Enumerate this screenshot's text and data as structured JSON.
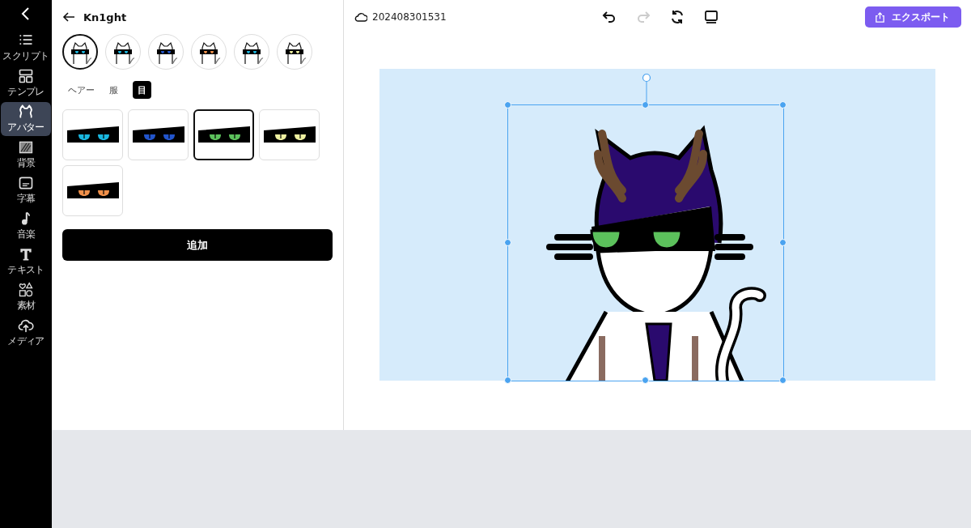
{
  "sidebar": {
    "items": [
      {
        "kind": "script",
        "label": "スクリプト",
        "selected": false
      },
      {
        "kind": "template",
        "label": "テンプレ",
        "selected": false
      },
      {
        "kind": "avatar",
        "label": "アバター",
        "selected": true
      },
      {
        "kind": "background",
        "label": "背景",
        "selected": false
      },
      {
        "kind": "subtitle",
        "label": "字幕",
        "selected": false
      },
      {
        "kind": "music",
        "label": "音楽",
        "selected": false
      },
      {
        "kind": "text",
        "label": "テキスト",
        "selected": false
      },
      {
        "kind": "material",
        "label": "素材",
        "selected": false
      },
      {
        "kind": "media",
        "label": "メディア",
        "selected": false
      }
    ]
  },
  "panel": {
    "title": "Kn1ght",
    "avatars": [
      {
        "color": "#1ab7df",
        "selected": true
      },
      {
        "color": "#1ab7df",
        "selected": false
      },
      {
        "color": "#2255cc",
        "selected": false
      },
      {
        "color": "#f0904a",
        "selected": false
      },
      {
        "color": "#1ab7df",
        "selected": false
      },
      {
        "color": "#eef0a0",
        "selected": false
      }
    ],
    "tabs": [
      {
        "label": "ヘアー",
        "selected": false
      },
      {
        "label": "服",
        "selected": false
      },
      {
        "label": "目",
        "selected": true
      }
    ],
    "options": [
      {
        "color": "#1ab7df",
        "selected": false
      },
      {
        "color": "#2255cc",
        "selected": false
      },
      {
        "color": "#5cc15c",
        "selected": true
      },
      {
        "color": "#eef0a0",
        "selected": false
      },
      {
        "color": "#f0904a",
        "selected": false
      }
    ],
    "add_button": "追加"
  },
  "toolbar": {
    "project_name": "202408301531",
    "redo_disabled": true,
    "export_button": "エクスポート"
  },
  "canvas": {
    "color": "#5cc15c"
  }
}
